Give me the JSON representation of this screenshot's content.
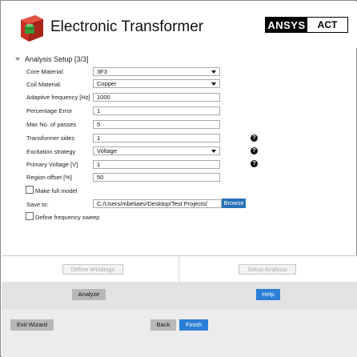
{
  "header": {
    "title": "Electronic Transformer",
    "brand": "ANSYS",
    "brand_suffix": "ACT"
  },
  "section": {
    "title": "Analysis Setup [3/3]"
  },
  "form": {
    "core_material": {
      "label": "Core Material:",
      "value": "3F3"
    },
    "coil_material": {
      "label": "Coil Material:",
      "value": "Copper"
    },
    "adaptive_frequency": {
      "label": "Adaptive frequency [Hz]",
      "value": "1000"
    },
    "percentage_error": {
      "label": "Percentage Error",
      "value": "1"
    },
    "max_passes": {
      "label": "Max No. of passes",
      "value": "5"
    },
    "transformer_sides": {
      "label": "Transformer sides",
      "value": "1"
    },
    "excitation_strategy": {
      "label": "Excitation strategy",
      "value": "Voltage"
    },
    "primary_voltage": {
      "label": "Primary Voltage [V]",
      "value": "1"
    },
    "region_offset": {
      "label": "Region offset [%]",
      "value": "50"
    },
    "make_full_model": {
      "label": "Make full model",
      "checked": false
    },
    "save_to": {
      "label": "Save to:",
      "value": "C:/Users/mbeliaev/Desktop/Test Projects/",
      "browse_label": "Browse"
    },
    "define_sweep": {
      "label": "Define frequency sweep",
      "checked": false
    },
    "help_glyph": "?"
  },
  "nav": {
    "define_windings": "Define Windings",
    "setup_analysis": "Setup Analysis"
  },
  "actions": {
    "analyze": "Analyze",
    "help": "Help"
  },
  "footer": {
    "exit": "Exit Wizard",
    "back": "Back",
    "finish": "Finish"
  },
  "colors": {
    "accent_blue": "#2b7fd6",
    "logo_red": "#d63a2a",
    "logo_green": "#3a9a3a"
  }
}
